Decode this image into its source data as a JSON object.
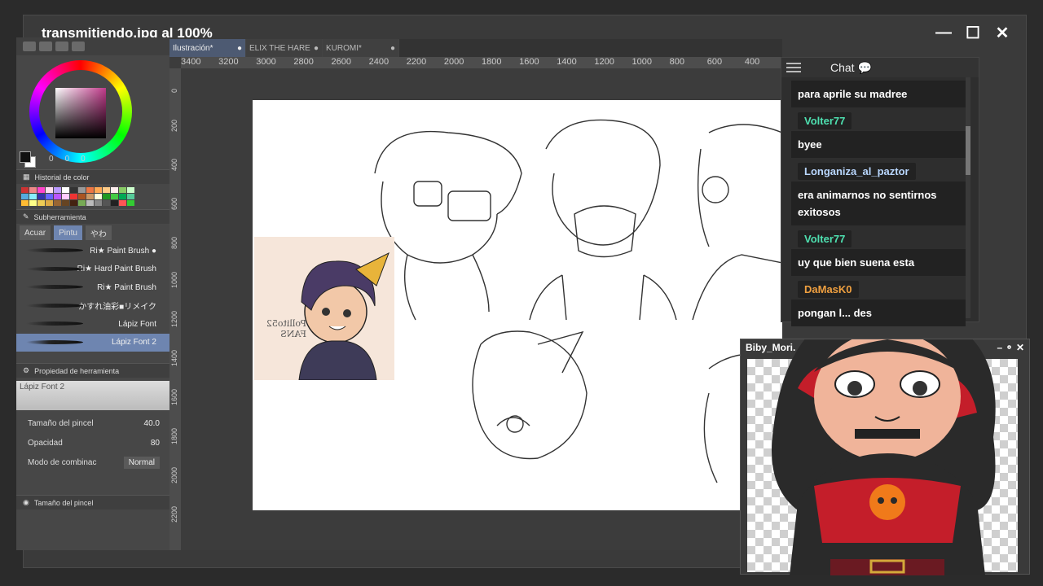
{
  "window": {
    "title": "transmitiendo.jpg al 100%",
    "minimize": "—",
    "maximize": "☐",
    "close": "✕"
  },
  "color_panel": {
    "r": "0",
    "g": "0",
    "b": "0"
  },
  "sections": {
    "history": "Historial de color",
    "subtool": "Subherramienta",
    "tool_property": "Propiedad de herramienta",
    "brush_size": "Tamaño del pincel"
  },
  "subtool_tabs": [
    "Acuar",
    "Pintu",
    "やわ"
  ],
  "brushes": [
    "Ri★ Paint Brush ●",
    "Ri★ Hard Paint Brush",
    "Ri★ Paint Brush",
    "かすれ油彩■リメイク",
    "Lápiz Font",
    "Lápiz Font 2"
  ],
  "tool_property": {
    "preview_label": "Lápiz Font 2",
    "size_label": "Tamaño del pincel",
    "size_value": "40.0",
    "opacity_label": "Opacidad",
    "opacity_value": "80",
    "blend_label": "Modo de combinac",
    "blend_value": "Normal"
  },
  "doc_tabs": [
    {
      "label": "Ilustración*",
      "active": true
    },
    {
      "label": "ELIX THE HARE",
      "active": false
    },
    {
      "label": "KUROMI*",
      "active": false
    }
  ],
  "ruler_top": [
    "3400",
    "3200",
    "3000",
    "2800",
    "2600",
    "2400",
    "2200",
    "2000",
    "1800",
    "1600",
    "1400",
    "1200",
    "1000",
    "800",
    "600",
    "400"
  ],
  "ruler_left": [
    "0",
    "200",
    "400",
    "600",
    "800",
    "1000",
    "1200",
    "1400",
    "1600",
    "1800",
    "2000",
    "2200"
  ],
  "sticker_text": "Pollito52 FANS",
  "chat": {
    "title": "Chat",
    "messages": [
      {
        "name": "",
        "text": "para aprile su madree",
        "color": "#ffffff"
      },
      {
        "name": "Volter77",
        "text": "byee",
        "color": "#4ee0b0"
      },
      {
        "name": "Longaniza_al_paztor",
        "text": "era animarnos no sentirnos exitosos",
        "color": "#b9d7ff"
      },
      {
        "name": "Volter77",
        "text": "uy que bien suena esta",
        "color": "#4ee0b0"
      },
      {
        "name": "DaMasK0",
        "text": "pongan l... des",
        "color": "#f0a040"
      }
    ]
  },
  "avatar_window": {
    "title": "Biby_Mori.",
    "controls": "– ⚬ ✕"
  },
  "colors": {
    "accent": "#6e85b0",
    "panel": "#474747",
    "chat_bg": "#2e2e2e"
  }
}
